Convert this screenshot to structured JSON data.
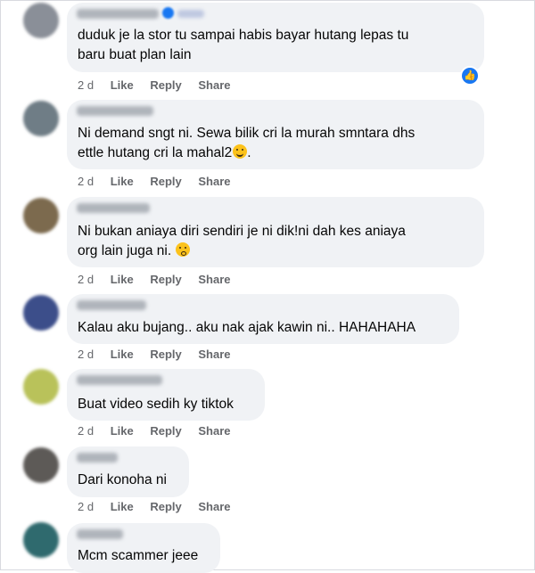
{
  "comments": [
    {
      "text_lines": [
        "duduk je la stor tu sampai habis bayar hutang lepas tu",
        "baru buat plan lain"
      ],
      "time": "2 d",
      "like": "Like",
      "reply": "Reply",
      "share": "Share",
      "avatar_color": "#8a8f98"
    },
    {
      "text_lines": [
        "Ni demand sngt ni. Sewa bilik cri la murah smntara dhs",
        "ettle hutang cri la mahal2"
      ],
      "text_suffix": ".",
      "time": "2 d",
      "like": "Like",
      "reply": "Reply",
      "share": "Share",
      "avatar_color": "#6f7d86"
    },
    {
      "text_lines": [
        "Ni bukan aniaya diri sendiri je ni dik!ni dah kes aniaya",
        "org lain juga ni. "
      ],
      "time": "2 d",
      "like": "Like",
      "reply": "Reply",
      "share": "Share",
      "avatar_color": "#7c6a4e"
    },
    {
      "text_lines": [
        "Kalau aku bujang.. aku nak ajak kawin ni.. HAHAHAHA"
      ],
      "time": "2 d",
      "like": "Like",
      "reply": "Reply",
      "share": "Share",
      "avatar_color": "#3c4e8a"
    },
    {
      "text_lines": [
        "Buat video sedih ky tiktok"
      ],
      "time": "2 d",
      "like": "Like",
      "reply": "Reply",
      "share": "Share",
      "avatar_color": "#b9c25a"
    },
    {
      "text_lines": [
        "Dari konoha ni"
      ],
      "time": "2 d",
      "like": "Like",
      "reply": "Reply",
      "share": "Share",
      "avatar_color": "#5d5a57"
    },
    {
      "text_lines": [
        "Mcm scammer jeee"
      ],
      "avatar_color": "#2f6a6e"
    }
  ],
  "colors": {
    "bubble": "#f0f2f5",
    "text": "#050505",
    "meta": "#65676b",
    "accent": "#1877f2"
  },
  "icons": {
    "like_reaction": "thumbs-up-icon",
    "grin_emoji": "grinning-sweat-emoji-icon",
    "eye_roll_emoji": "face-with-rolling-eyes-emoji-icon"
  },
  "reaction_badge_glyph": "👍"
}
